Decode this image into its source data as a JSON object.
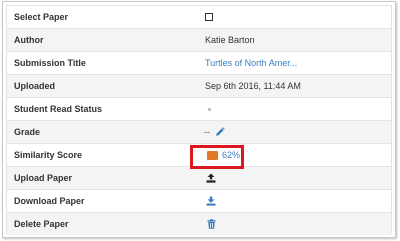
{
  "rows": [
    {
      "label": "Select Paper"
    },
    {
      "label": "Author",
      "value": "Katie Barton"
    },
    {
      "label": "Submission Title",
      "value": "Turtles of North Amer..."
    },
    {
      "label": "Uploaded",
      "value": "Sep 6th 2016, 11:44 AM"
    },
    {
      "label": "Student Read Status"
    },
    {
      "label": "Grade",
      "value": "--"
    },
    {
      "label": "Similarity Score",
      "value": "62%"
    },
    {
      "label": "Upload Paper"
    },
    {
      "label": "Download Paper"
    },
    {
      "label": "Delete Paper"
    }
  ],
  "colors": {
    "link": "#3a7ec0",
    "similarity_swatch": "#e07a28",
    "highlight_border": "#d9191f"
  },
  "icons": {
    "grade_edit": "pencil-icon",
    "upload": "upload-icon",
    "download": "download-icon",
    "delete": "trash-icon"
  }
}
